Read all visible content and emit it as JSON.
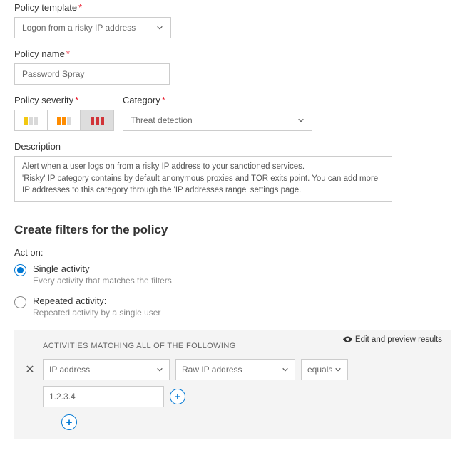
{
  "labels": {
    "policy_template": "Policy template",
    "policy_name": "Policy name",
    "policy_severity": "Policy severity",
    "category": "Category",
    "description": "Description"
  },
  "template": {
    "value": "Logon from a risky IP address"
  },
  "name": {
    "value": "Password Spray"
  },
  "category": {
    "value": "Threat detection"
  },
  "description": {
    "value": "Alert when a user logs on from a risky IP address to your sanctioned services.\n'Risky' IP category contains by default anonymous proxies and TOR exits point. You can add more IP addresses to this category through the 'IP addresses range' settings page."
  },
  "filters": {
    "section_title": "Create filters for the policy",
    "act_on_label": "Act on:",
    "single": {
      "title": "Single activity",
      "sub": "Every activity that matches the filters"
    },
    "repeated": {
      "title": "Repeated activity:",
      "sub": "Repeated activity by a single user"
    },
    "panel_head": "ACTIVITIES MATCHING ALL OF THE FOLLOWING",
    "preview": "Edit and preview results",
    "field": "IP address",
    "subfield": "Raw IP address",
    "op": "equals",
    "value": "1.2.3.4"
  }
}
